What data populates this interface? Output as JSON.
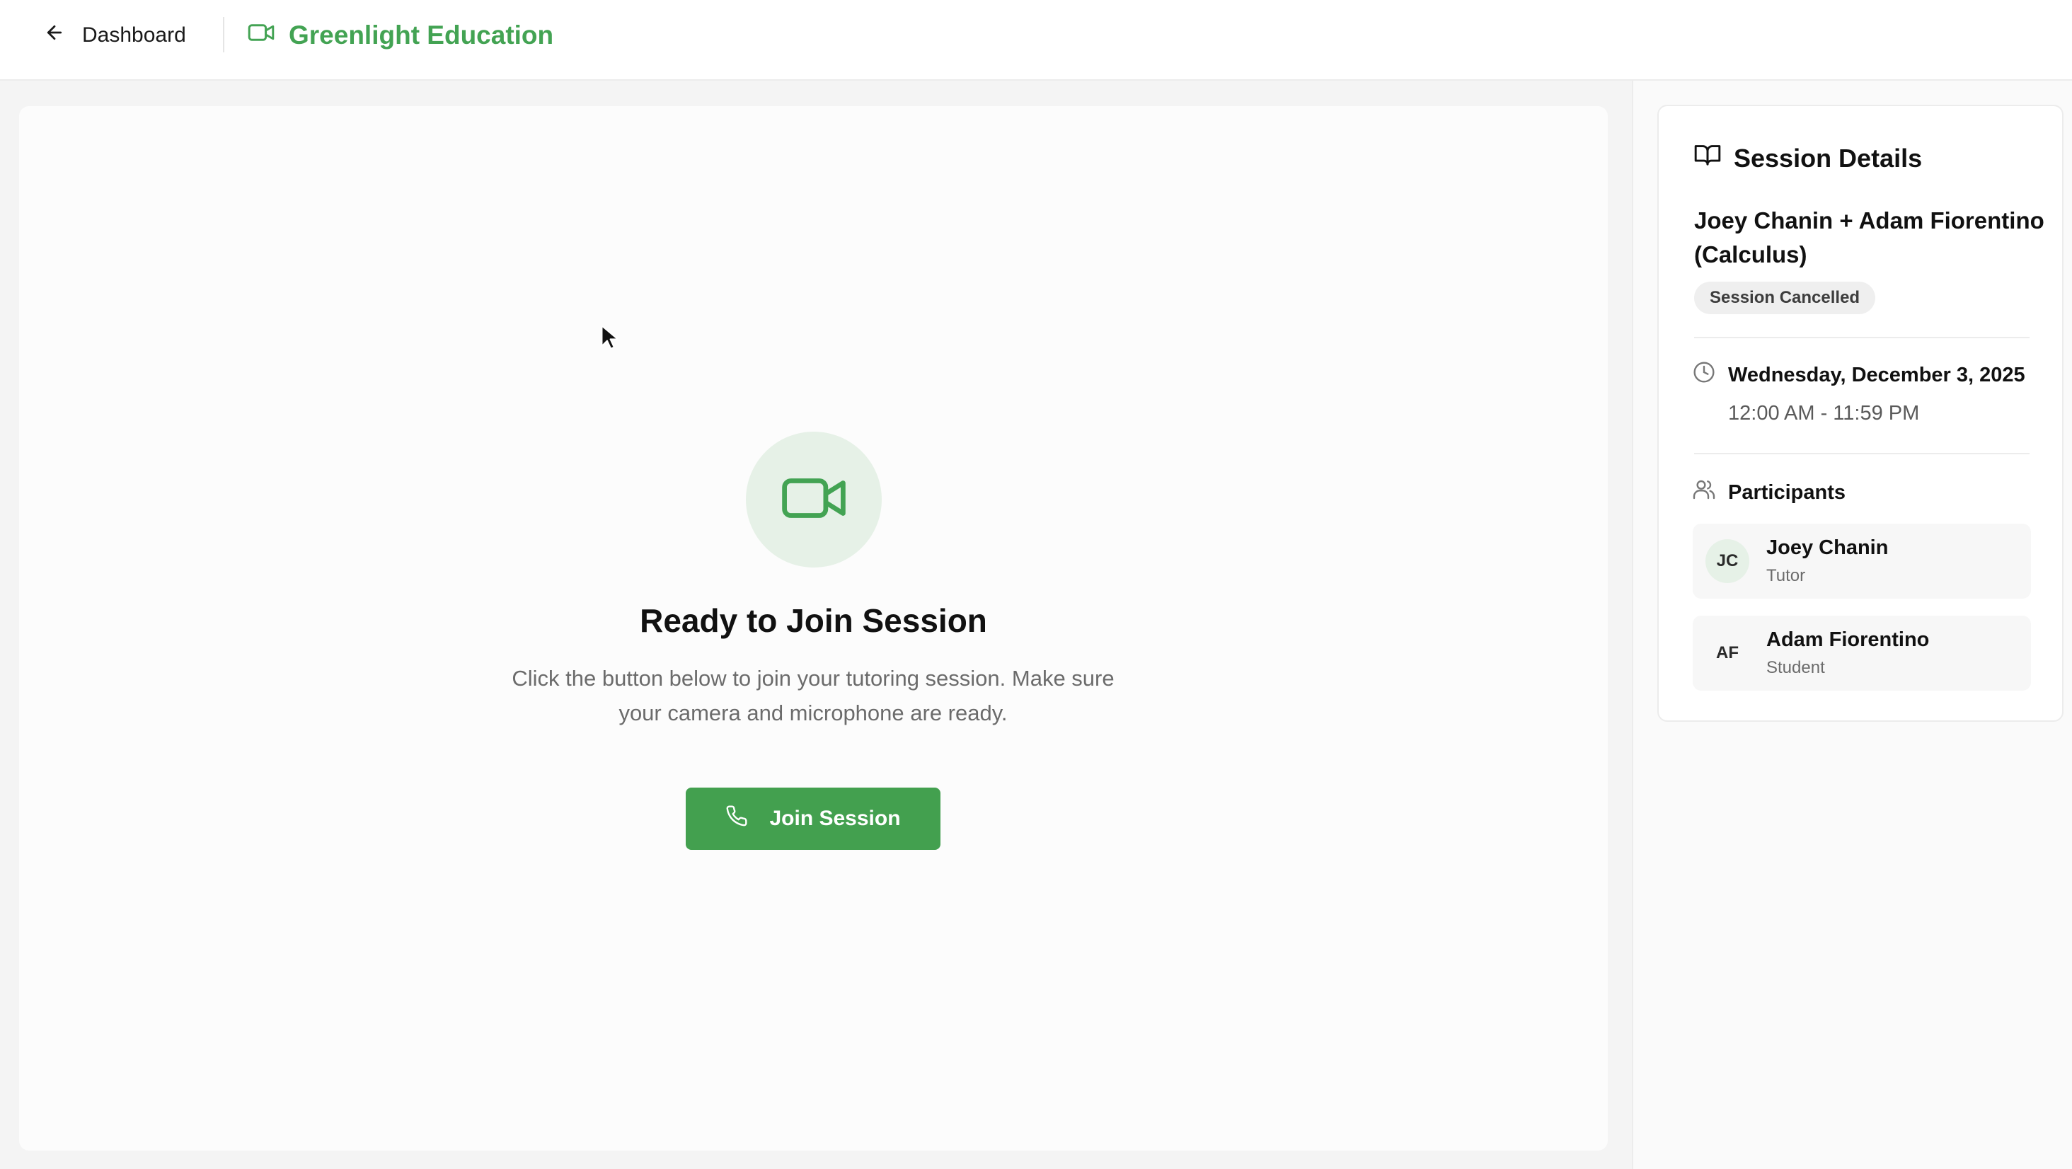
{
  "header": {
    "back_label": "Dashboard",
    "brand": "Greenlight Education",
    "brand_color": "#43a353"
  },
  "main": {
    "icon": "video-camera-icon",
    "title": "Ready to Join Session",
    "description": "Click the button below to join your tutoring session. Make sure your camera and microphone are ready.",
    "join_button": {
      "label": "Join Session",
      "icon": "phone-icon",
      "color": "#43a04f"
    }
  },
  "sidebar": {
    "heading": "Session Details",
    "heading_icon": "book-open-icon",
    "session_name": "Joey Chanin + Adam Fiorentino (Calculus)",
    "status": "Session Cancelled",
    "date_icon": "clock-icon",
    "date": "Wednesday, December 3, 2025",
    "time": "12:00 AM - 11:59 PM",
    "participants_heading": "Participants",
    "participants_icon": "users-icon",
    "participants": [
      {
        "initials": "JC",
        "name": "Joey Chanin",
        "role": "Tutor"
      },
      {
        "initials": "AF",
        "name": "Adam Fiorentino",
        "role": "Student"
      }
    ]
  }
}
